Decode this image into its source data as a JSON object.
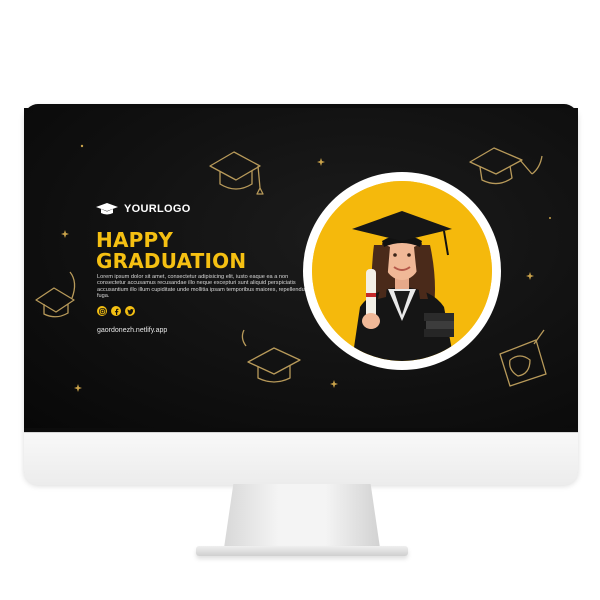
{
  "banner": {
    "logo_text": "YOURLOGO",
    "headline_line1": "HAPPY",
    "headline_line2": "GRADUATION",
    "body_text": "Lorem ipsum dolor sit amet, consectetur adipisicing elit, iusto eaque ea a non consectetur accusamus recusandae illo neque excepturi sunt aliquid perspiciatis accusantium illo illum cupiditate unde mollitia ipsam temporibus maiores, repellendus fuga.",
    "socials": [
      "instagram-icon",
      "facebook-icon",
      "twitter-icon"
    ],
    "url": "gaordonezh.netlify.app"
  },
  "colors": {
    "accent": "#f5c012",
    "background": "#0e0e0e",
    "decoration": "#b89a5a",
    "text": "#ffffff"
  }
}
